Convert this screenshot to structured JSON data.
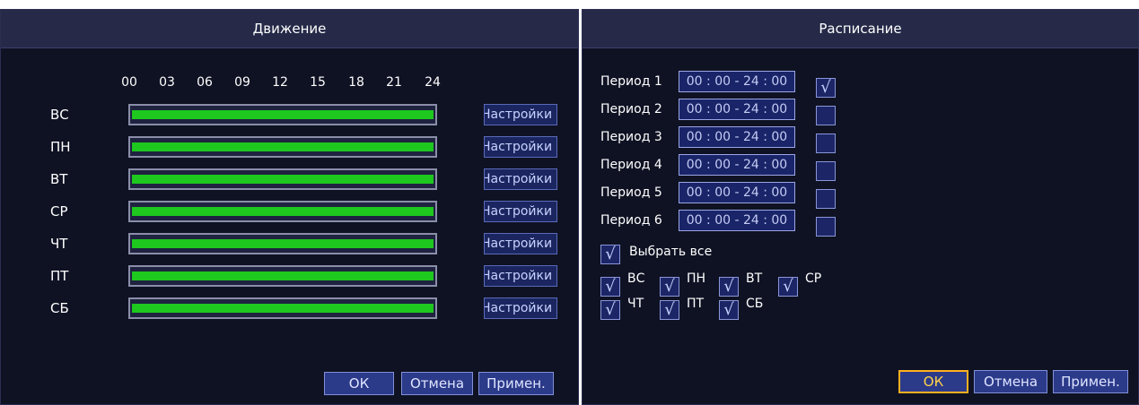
{
  "motion": {
    "title": "Движение",
    "hours": [
      "00",
      "03",
      "06",
      "09",
      "12",
      "15",
      "18",
      "21",
      "24"
    ],
    "days": [
      {
        "label": "ВС",
        "setup": "Настройки",
        "coverage": 1.0
      },
      {
        "label": "ПН",
        "setup": "Настройки",
        "coverage": 1.0
      },
      {
        "label": "ВТ",
        "setup": "Настройки",
        "coverage": 1.0
      },
      {
        "label": "СР",
        "setup": "Настройки",
        "coverage": 1.0
      },
      {
        "label": "ЧТ",
        "setup": "Настройки",
        "coverage": 1.0
      },
      {
        "label": "ПТ",
        "setup": "Настройки",
        "coverage": 1.0
      },
      {
        "label": "СБ",
        "setup": "Настройки",
        "coverage": 1.0
      }
    ],
    "buttons": {
      "ok": "ОК",
      "cancel": "Отмена",
      "apply": "Примен."
    },
    "colors": {
      "schedule_fill": "#1ec81e",
      "panel_bg": "#0f1223"
    }
  },
  "schedule": {
    "title": "Расписание",
    "periods": [
      {
        "label": "Период 1",
        "value": "00 : 00 - 24 : 00",
        "checked": true
      },
      {
        "label": "Период 2",
        "value": "00 : 00 - 24 : 00",
        "checked": false
      },
      {
        "label": "Период 3",
        "value": "00 : 00 - 24 : 00",
        "checked": false
      },
      {
        "label": "Период 4",
        "value": "00 : 00 - 24 : 00",
        "checked": false
      },
      {
        "label": "Период 5",
        "value": "00 : 00 - 24 : 00",
        "checked": false
      },
      {
        "label": "Период 6",
        "value": "00 : 00 - 24 : 00",
        "checked": false
      }
    ],
    "select_all": {
      "label": "Выбрать все",
      "checked": true
    },
    "days_row1": [
      {
        "label": "ВС",
        "checked": true
      },
      {
        "label": "ПН",
        "checked": true
      },
      {
        "label": "ВТ",
        "checked": true
      },
      {
        "label": "СР",
        "checked": true
      }
    ],
    "days_row2": [
      {
        "label": "ЧТ",
        "checked": true
      },
      {
        "label": "ПТ",
        "checked": true
      },
      {
        "label": "СБ",
        "checked": true
      }
    ],
    "check_glyph": "√",
    "buttons": {
      "ok": "ОК",
      "cancel": "Отмена",
      "apply": "Примен."
    }
  }
}
